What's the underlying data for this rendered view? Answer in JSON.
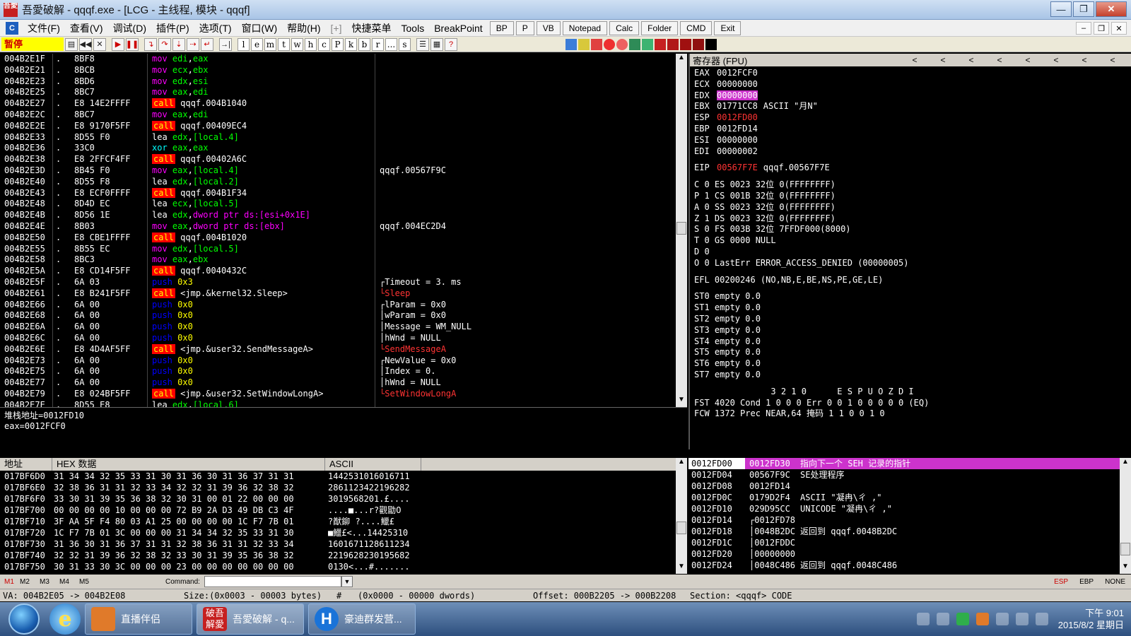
{
  "window": {
    "title": "吾愛破解 - qqqf.exe - [LCG - 主线程, 模块 - qqqf]",
    "app_icon_text": "吾愛",
    "controls": [
      "—",
      "❐",
      "✕"
    ]
  },
  "menubar": {
    "items": [
      "文件(F)",
      "查看(V)",
      "调试(D)",
      "插件(P)",
      "选项(T)",
      "窗口(W)",
      "帮助(H)",
      "[+]",
      "快捷菜单",
      "Tools",
      "BreakPoint"
    ],
    "plugin_buttons": [
      "BP",
      "P",
      "VB",
      "Notepad",
      "Calc",
      "Folder",
      "CMD",
      "Exit"
    ],
    "mdi_controls": [
      "–",
      "❐",
      "✕"
    ]
  },
  "toolbar": {
    "status": "暂停",
    "letters": [
      "l",
      "e",
      "m",
      "t",
      "w",
      "h",
      "c",
      "P",
      "k",
      "b",
      "r",
      "...",
      "s"
    ]
  },
  "disasm": [
    {
      "addr": "004B2E1F",
      "mark": ".",
      "hex": "8BF8",
      "op": "mov",
      "args": [
        [
          "reg",
          "edi"
        ],
        [
          "t",
          ","
        ],
        [
          "reg",
          "eax"
        ]
      ],
      "cmt": "",
      "cr": false
    },
    {
      "addr": "004B2E21",
      "mark": ".",
      "hex": "8BCB",
      "op": "mov",
      "args": [
        [
          "reg",
          "ecx"
        ],
        [
          "t",
          ","
        ],
        [
          "reg",
          "ebx"
        ]
      ],
      "cmt": "",
      "cr": false
    },
    {
      "addr": "004B2E23",
      "mark": ".",
      "hex": "8BD6",
      "op": "mov",
      "args": [
        [
          "reg",
          "edx"
        ],
        [
          "t",
          ","
        ],
        [
          "reg",
          "esi"
        ]
      ],
      "cmt": "",
      "cr": false
    },
    {
      "addr": "004B2E25",
      "mark": ".",
      "hex": "8BC7",
      "op": "mov",
      "args": [
        [
          "reg",
          "eax"
        ],
        [
          "t",
          ","
        ],
        [
          "reg",
          "edi"
        ]
      ],
      "cmt": "",
      "cr": false
    },
    {
      "addr": "004B2E27",
      "mark": ".",
      "hex": "E8 14E2FFFF",
      "op": "call",
      "args": [
        [
          "t",
          "qqqf.004B1040"
        ]
      ],
      "cmt": "",
      "cr": false
    },
    {
      "addr": "004B2E2C",
      "mark": ".",
      "hex": "8BC7",
      "op": "mov",
      "args": [
        [
          "reg",
          "eax"
        ],
        [
          "t",
          ","
        ],
        [
          "reg",
          "edi"
        ]
      ],
      "cmt": "",
      "cr": false
    },
    {
      "addr": "004B2E2E",
      "mark": ".",
      "hex": "E8 9170F5FF",
      "op": "call",
      "args": [
        [
          "t",
          "qqqf.00409EC4"
        ]
      ],
      "cmt": "",
      "cr": false
    },
    {
      "addr": "004B2E33",
      "mark": ".",
      "hex": "8D55 F0",
      "op": "lea",
      "args": [
        [
          "reg",
          "edx"
        ],
        [
          "t",
          ","
        ],
        [
          "reg",
          "[local.4]"
        ]
      ],
      "cmt": "",
      "cr": false
    },
    {
      "addr": "004B2E36",
      "mark": ".",
      "hex": "33C0",
      "op": "xor",
      "args": [
        [
          "reg",
          "eax"
        ],
        [
          "t",
          ","
        ],
        [
          "reg",
          "eax"
        ]
      ],
      "cmt": "",
      "cr": false
    },
    {
      "addr": "004B2E38",
      "mark": ".",
      "hex": "E8 2FFCF4FF",
      "op": "call",
      "args": [
        [
          "t",
          "qqqf.00402A6C"
        ]
      ],
      "cmt": "",
      "cr": false
    },
    {
      "addr": "004B2E3D",
      "mark": ".",
      "hex": "8B45 F0",
      "op": "mov",
      "args": [
        [
          "reg",
          "eax"
        ],
        [
          "t",
          ","
        ],
        [
          "reg",
          "[local.4]"
        ]
      ],
      "cmt": "qqqf.00567F9C",
      "cr": false
    },
    {
      "addr": "004B2E40",
      "mark": ".",
      "hex": "8D55 F8",
      "op": "lea",
      "args": [
        [
          "reg",
          "edx"
        ],
        [
          "t",
          ","
        ],
        [
          "reg",
          "[local.2]"
        ]
      ],
      "cmt": "",
      "cr": false
    },
    {
      "addr": "004B2E43",
      "mark": ".",
      "hex": "E8 ECF0FFFF",
      "op": "call",
      "args": [
        [
          "t",
          "qqqf.004B1F34"
        ]
      ],
      "cmt": "",
      "cr": false
    },
    {
      "addr": "004B2E48",
      "mark": ".",
      "hex": "8D4D EC",
      "op": "lea",
      "args": [
        [
          "reg",
          "ecx"
        ],
        [
          "t",
          ","
        ],
        [
          "reg",
          "[local.5]"
        ]
      ],
      "cmt": "",
      "cr": false
    },
    {
      "addr": "004B2E4B",
      "mark": ".",
      "hex": "8D56 1E",
      "op": "lea",
      "args": [
        [
          "reg",
          "edx"
        ],
        [
          "t",
          ","
        ],
        [
          "mem",
          "dword ptr ds:[esi+0x1E]"
        ]
      ],
      "cmt": "",
      "cr": false
    },
    {
      "addr": "004B2E4E",
      "mark": ".",
      "hex": "8B03",
      "op": "mov",
      "args": [
        [
          "reg",
          "eax"
        ],
        [
          "t",
          ","
        ],
        [
          "mem",
          "dword ptr ds:[ebx]"
        ]
      ],
      "cmt": "qqqf.004EC2D4",
      "cr": false
    },
    {
      "addr": "004B2E50",
      "mark": ".",
      "hex": "E8 CBE1FFFF",
      "op": "call",
      "args": [
        [
          "t",
          "qqqf.004B1020"
        ]
      ],
      "cmt": "",
      "cr": false
    },
    {
      "addr": "004B2E55",
      "mark": ".",
      "hex": "8B55 EC",
      "op": "mov",
      "args": [
        [
          "reg",
          "edx"
        ],
        [
          "t",
          ","
        ],
        [
          "reg",
          "[local.5]"
        ]
      ],
      "cmt": "",
      "cr": false
    },
    {
      "addr": "004B2E58",
      "mark": ".",
      "hex": "8BC3",
      "op": "mov",
      "args": [
        [
          "reg",
          "eax"
        ],
        [
          "t",
          ","
        ],
        [
          "reg",
          "ebx"
        ]
      ],
      "cmt": "",
      "cr": false
    },
    {
      "addr": "004B2E5A",
      "mark": ".",
      "hex": "E8 CD14F5FF",
      "op": "call",
      "args": [
        [
          "t",
          "qqqf.0040432C"
        ]
      ],
      "cmt": "",
      "cr": false
    },
    {
      "addr": "004B2E5F",
      "mark": ".",
      "hex": "6A 03",
      "op": "push",
      "args": [
        [
          "num",
          "0x3"
        ]
      ],
      "cmt": "┌Timeout = 3. ms",
      "cr": false
    },
    {
      "addr": "004B2E61",
      "mark": ".",
      "hex": "E8 B241F5FF",
      "op": "call",
      "args": [
        [
          "t",
          "<jmp.&kernel32.Sleep>"
        ]
      ],
      "cmt": "└Sleep",
      "cr": true
    },
    {
      "addr": "004B2E66",
      "mark": ".",
      "hex": "6A 00",
      "op": "push",
      "args": [
        [
          "num",
          "0x0"
        ]
      ],
      "cmt": "┌lParam = 0x0",
      "cr": false
    },
    {
      "addr": "004B2E68",
      "mark": ".",
      "hex": "6A 00",
      "op": "push",
      "args": [
        [
          "num",
          "0x0"
        ]
      ],
      "cmt": "│wParam = 0x0",
      "cr": false
    },
    {
      "addr": "004B2E6A",
      "mark": ".",
      "hex": "6A 00",
      "op": "push",
      "args": [
        [
          "num",
          "0x0"
        ]
      ],
      "cmt": "│Message = WM_NULL",
      "cr": false
    },
    {
      "addr": "004B2E6C",
      "mark": ".",
      "hex": "6A 00",
      "op": "push",
      "args": [
        [
          "num",
          "0x0"
        ]
      ],
      "cmt": "│hWnd = NULL",
      "cr": false
    },
    {
      "addr": "004B2E6E",
      "mark": ".",
      "hex": "E8 4D4AF5FF",
      "op": "call",
      "args": [
        [
          "t",
          "<jmp.&user32.SendMessageA>"
        ]
      ],
      "cmt": "└SendMessageA",
      "cr": true
    },
    {
      "addr": "004B2E73",
      "mark": ".",
      "hex": "6A 00",
      "op": "push",
      "args": [
        [
          "num",
          "0x0"
        ]
      ],
      "cmt": "┌NewValue = 0x0",
      "cr": false
    },
    {
      "addr": "004B2E75",
      "mark": ".",
      "hex": "6A 00",
      "op": "push",
      "args": [
        [
          "num",
          "0x0"
        ]
      ],
      "cmt": "│Index = 0.",
      "cr": false
    },
    {
      "addr": "004B2E77",
      "mark": ".",
      "hex": "6A 00",
      "op": "push",
      "args": [
        [
          "num",
          "0x0"
        ]
      ],
      "cmt": "│hWnd = NULL",
      "cr": false
    },
    {
      "addr": "004B2E79",
      "mark": ".",
      "hex": "E8 024BF5FF",
      "op": "call",
      "args": [
        [
          "t",
          "<jmp.&user32.SetWindowLongA>"
        ]
      ],
      "cmt": "└SetWindowLongA",
      "cr": true
    },
    {
      "addr": "004B2E7E",
      "mark": ".",
      "hex": "8D55 E8",
      "op": "lea",
      "args": [
        [
          "reg",
          "edx"
        ],
        [
          "t",
          ","
        ],
        [
          "reg",
          "[local.6]"
        ]
      ],
      "cmt": "",
      "cr": false
    }
  ],
  "info": {
    "line1": "堆栈地址=0012FD10",
    "line2": "eax=0012FCF0"
  },
  "registers": {
    "header": "寄存器 (FPU)",
    "nav": [
      "<",
      "<",
      "<",
      "<",
      "<",
      "<",
      "<",
      "<"
    ],
    "gp": [
      {
        "name": "EAX",
        "val": "0012FCF0",
        "extra": "",
        "hl": ""
      },
      {
        "name": "ECX",
        "val": "00000000",
        "extra": "",
        "hl": ""
      },
      {
        "name": "EDX",
        "val": "00000000",
        "extra": "",
        "hl": "mag"
      },
      {
        "name": "EBX",
        "val": "01771CC8",
        "extra": "ASCII \"月N\"",
        "hl": ""
      },
      {
        "name": "ESP",
        "val": "0012FD00",
        "extra": "",
        "hl": "red"
      },
      {
        "name": "EBP",
        "val": "0012FD14",
        "extra": "",
        "hl": ""
      },
      {
        "name": "ESI",
        "val": "00000000",
        "extra": "",
        "hl": ""
      },
      {
        "name": "EDI",
        "val": "00000002",
        "extra": "",
        "hl": ""
      }
    ],
    "eip": {
      "name": "EIP",
      "val": "00567F7E",
      "extra": "qqqf.00567F7E"
    },
    "flags": [
      "C 0  ES 0023 32位 0(FFFFFFFF)",
      "P 1  CS 001B 32位 0(FFFFFFFF)",
      "A 0  SS 0023 32位 0(FFFFFFFF)",
      "Z 1  DS 0023 32位 0(FFFFFFFF)",
      "S 0  FS 003B 32位 7FFDF000(8000)",
      "T 0  GS 0000 NULL",
      "D 0",
      "O 0  LastErr ERROR_ACCESS_DENIED (00000005)"
    ],
    "efl": "EFL 00200246 (NO,NB,E,BE,NS,PE,GE,LE)",
    "st": [
      "ST0 empty 0.0",
      "ST1 empty 0.0",
      "ST2 empty 0.0",
      "ST3 empty 0.0",
      "ST4 empty 0.0",
      "ST5 empty 0.0",
      "ST6 empty 0.0",
      "ST7 empty 0.0"
    ],
    "fpu_hdr": "               3 2 1 0      E S P U O Z D I",
    "fst": "FST 4020  Cond 1 0 0 0  Err 0 0 1 0 0 0 0 0  (EQ)",
    "fcw": "FCW 1372  Prec NEAR,64  掩码    1 1 0 0 1 0"
  },
  "dump": {
    "headers": [
      "地址",
      "HEX 数据",
      "ASCII"
    ],
    "rows": [
      {
        "addr": "017BF6D0",
        "hex": "31 34 34 32 35 33 31 30 31 36 30 31 36 37 31 31",
        "ascii": "1442531016016711"
      },
      {
        "addr": "017BF6E0",
        "hex": "32 38 36 31 31 32 33 34 32 32 31 39 36 32 38 32",
        "ascii": "2861123422196282"
      },
      {
        "addr": "017BF6F0",
        "hex": "33 30 31 39 35 36 38 32 30 31 00 01 22 00 00 00",
        "ascii": "3019568201.£...."
      },
      {
        "addr": "017BF700",
        "hex": "00 00 00 00 10 00 00 00 72 B9 2A D3 49 DB C3 4F",
        "ascii": "....■...r?觀勖O"
      },
      {
        "addr": "017BF710",
        "hex": "3F AA 5F F4 80 03 A1 25 00 00 00 00 1C F7 7B 01",
        "ascii": "?猷鉚 ?....鱲£"
      },
      {
        "addr": "017BF720",
        "hex": "1C F7 7B 01 3C 00 00 00 31 34 34 32 35 33 31 30",
        "ascii": "■鱲£<...14425310"
      },
      {
        "addr": "017BF730",
        "hex": "31 36 30 31 36 37 31 31 32 38 36 31 31 32 33 34",
        "ascii": "1601671128611234"
      },
      {
        "addr": "017BF740",
        "hex": "32 32 31 39 36 32 38 32 33 30 31 39 35 36 38 32",
        "ascii": "2219628230195682"
      },
      {
        "addr": "017BF750",
        "hex": "30 31 33 30 3C 00 00 00 23 00 00 00 00 00 00 00",
        "ascii": "0130<...#......."
      }
    ]
  },
  "stack": [
    {
      "addr": "0012FD00",
      "val": "0012FD30",
      "cmt": "指向下一个 SEH 记录的指针",
      "top": true
    },
    {
      "addr": "0012FD04",
      "val": "00567F9C",
      "cmt": "SE处理程序",
      "top": false
    },
    {
      "addr": "0012FD08",
      "val": "0012FD14",
      "cmt": "",
      "top": false
    },
    {
      "addr": "0012FD0C",
      "val": "0179D2F4",
      "cmt": "ASCII \"凝冉\\ㄔ ,\"",
      "top": false
    },
    {
      "addr": "0012FD10",
      "val": "029D95CC",
      "cmt": "UNICODE \"凝冉\\ㄔ ,\"",
      "top": false
    },
    {
      "addr": "0012FD14",
      "val": "┌0012FD78",
      "cmt": "",
      "top": false
    },
    {
      "addr": "0012FD18",
      "val": "│0048B2DC",
      "cmt": "返回到 qqqf.0048B2DC",
      "top": false
    },
    {
      "addr": "0012FD1C",
      "val": "│0012FDDC",
      "cmt": "",
      "top": false
    },
    {
      "addr": "0012FD20",
      "val": "│00000000",
      "cmt": "",
      "top": false
    },
    {
      "addr": "0012FD24",
      "val": "│0048C486",
      "cmt": "返回到 qqqf.0048C486",
      "top": false
    }
  ],
  "cmdbar": {
    "tabs": [
      "M1",
      "M2",
      "M3",
      "M4",
      "M5"
    ],
    "label": "Command:",
    "right": [
      "ESP",
      "EBP",
      "NONE"
    ]
  },
  "status": {
    "va": "VA: 004B2E05 -> 004B2E08",
    "size": "Size:(0x0003 - 00003 bytes)",
    "hash": "#",
    "dwords": "(0x0000 - 00000 dwords)",
    "offset": "Offset: 000B2205 -> 000B2208",
    "section": "Section: <qqqf> CODE"
  },
  "taskbar": {
    "ie_glyph": "e",
    "tasks": [
      {
        "label": "直播伴侣",
        "icon_text": ""
      },
      {
        "label": "吾愛破解 - q...",
        "icon_text": "破吾\n解愛"
      },
      {
        "label": "豪迪群发营...",
        "icon_text": "H"
      }
    ],
    "time": "下午 9:01",
    "date": "2015/8/2 星期日"
  },
  "colors": {
    "call_bg": "#ff0000",
    "push": "#0000ff",
    "mov": "#ff00ff",
    "register": "#00ff00",
    "highlight": "#cc33cc",
    "status_paused": "#ffff00"
  }
}
